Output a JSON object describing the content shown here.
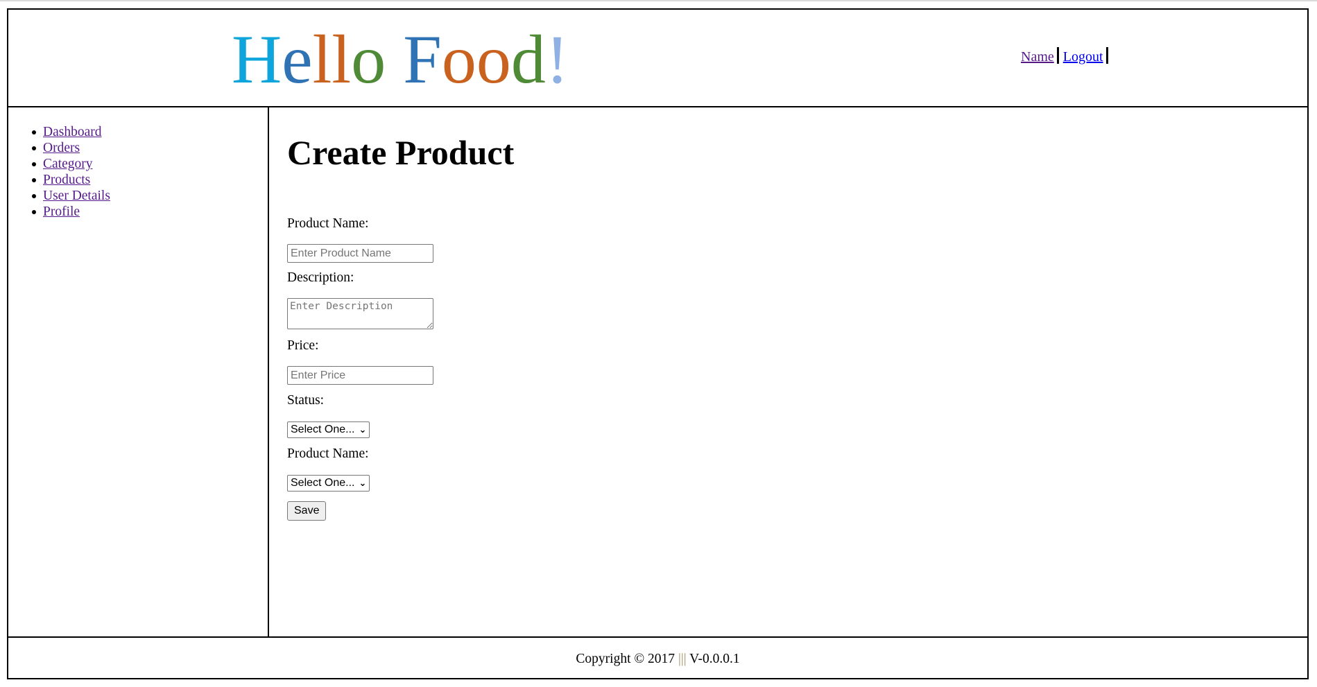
{
  "header": {
    "logo": {
      "letters": [
        {
          "ch": "H",
          "color": "#0ea5dd"
        },
        {
          "ch": "e",
          "color": "#2f73b5"
        },
        {
          "ch": "l",
          "color": "#c9611f"
        },
        {
          "ch": "l",
          "color": "#c9611f"
        },
        {
          "ch": "o",
          "color": "#4f8a37"
        },
        {
          "ch": " ",
          "color": "#000000"
        },
        {
          "ch": "F",
          "color": "#2f73b5"
        },
        {
          "ch": "o",
          "color": "#c9611f"
        },
        {
          "ch": "o",
          "color": "#c9611f"
        },
        {
          "ch": "d",
          "color": "#4f8a37"
        },
        {
          "ch": "!",
          "color": "#8fb0e2"
        }
      ]
    },
    "nav": {
      "name_label": "Name",
      "logout_label": "Logout",
      "name_color": "#551a8b",
      "logout_color": "#0000ee"
    }
  },
  "sidebar": {
    "items": [
      {
        "label": "Dashboard"
      },
      {
        "label": "Orders"
      },
      {
        "label": "Category"
      },
      {
        "label": "Products"
      },
      {
        "label": "User Details"
      },
      {
        "label": "Profile"
      }
    ]
  },
  "main": {
    "title": "Create Product",
    "form": {
      "product_name_label": "Product Name:",
      "product_name_placeholder": "Enter Product Name",
      "description_label": "Description:",
      "description_placeholder": "Enter Description",
      "price_label": "Price:",
      "price_placeholder": "Enter Price",
      "status_label": "Status:",
      "status_value": "Select One...",
      "product_name2_label": "Product Name:",
      "product_name2_value": "Select One...",
      "save_label": "Save"
    }
  },
  "footer": {
    "text_before": "Copyright © 2017 ",
    "pipes": "|||",
    "text_after": " V-0.0.0.1"
  }
}
